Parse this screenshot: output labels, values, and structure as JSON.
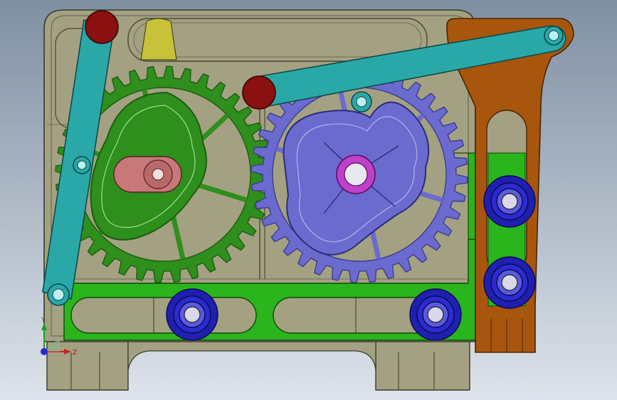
{
  "viewport": {
    "background_top": "#7f8fa3",
    "background_bottom": "#dde3ea"
  },
  "colors": {
    "frame": "#a3a181",
    "frame_dark": "#6f6d55",
    "gear_green": "#2e8f1c",
    "gear_green_dark": "#1d5c10",
    "gear_purple": "#6b6bcf",
    "gear_purple_dark": "#3c3c8f",
    "link_teal": "#2aa8a8",
    "link_teal_dark": "#176b6b",
    "pin_red": "#8b1010",
    "slider_green": "#2bb51c",
    "bracket_brown": "#a8560e",
    "bearing_blue": "#1f1fb0",
    "cam_rose": "#c87878",
    "hub_magenta": "#c040c8",
    "tab_yellow": "#c8c23a"
  },
  "triad": {
    "x_label": "X",
    "y_label": "Y",
    "z_label": "Z"
  },
  "model": {
    "left_gear_teeth": 36,
    "right_gear_teeth": 36
  }
}
